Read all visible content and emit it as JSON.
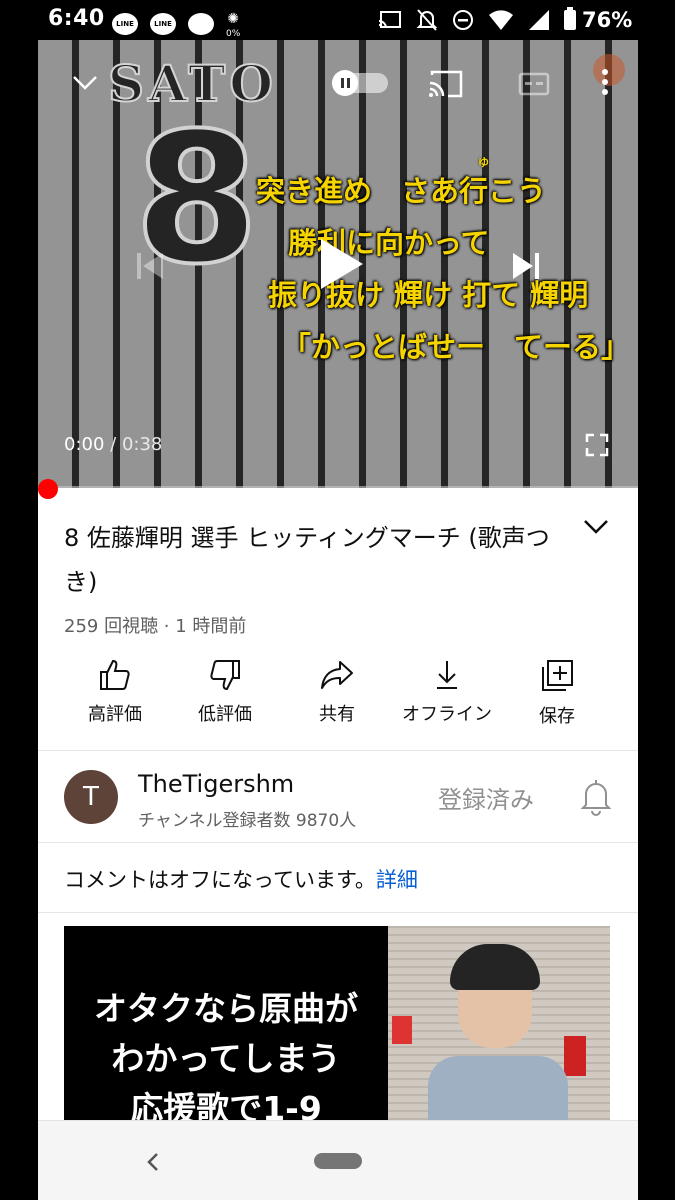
{
  "status_bar": {
    "time": "6:40",
    "notifications": [
      "LINE",
      "LINE"
    ],
    "data_saver": "0%",
    "battery": "76%"
  },
  "player": {
    "jersey_name": "SATO",
    "jersey_number": "8",
    "lyrics": {
      "line1": "突き進め　さあ行こう",
      "line2": "勝利に向かって",
      "line3": "振り抜け 輝け 打て 輝明",
      "line4": "「かっとばせー　てーる」",
      "ruby": "ゆ"
    },
    "time_current": "0:00",
    "time_separator": " / ",
    "time_total": "0:38",
    "progress": 0
  },
  "video": {
    "title": "8 佐藤輝明 選手 ヒッティングマーチ (歌声つき)",
    "meta": "259 回視聴 · 1 時間前"
  },
  "actions": {
    "like": "高評価",
    "dislike": "低評価",
    "share": "共有",
    "offline": "オフライン",
    "save": "保存"
  },
  "channel": {
    "avatar_letter": "T",
    "name": "TheTigershm",
    "subscribers": "チャンネル登録者数 9870人",
    "subscribed_label": "登録済み"
  },
  "comments": {
    "text": "コメントはオフになっています。",
    "link": "詳細"
  },
  "next_video": {
    "thumb_line1": "オタクなら原曲が",
    "thumb_line2": "わかってしまう",
    "thumb_line3": "応援歌で1-9"
  },
  "colors": {
    "accent_red": "#ff0000",
    "link_blue": "#065fd4",
    "lyrics_yellow": "#f5d400"
  }
}
